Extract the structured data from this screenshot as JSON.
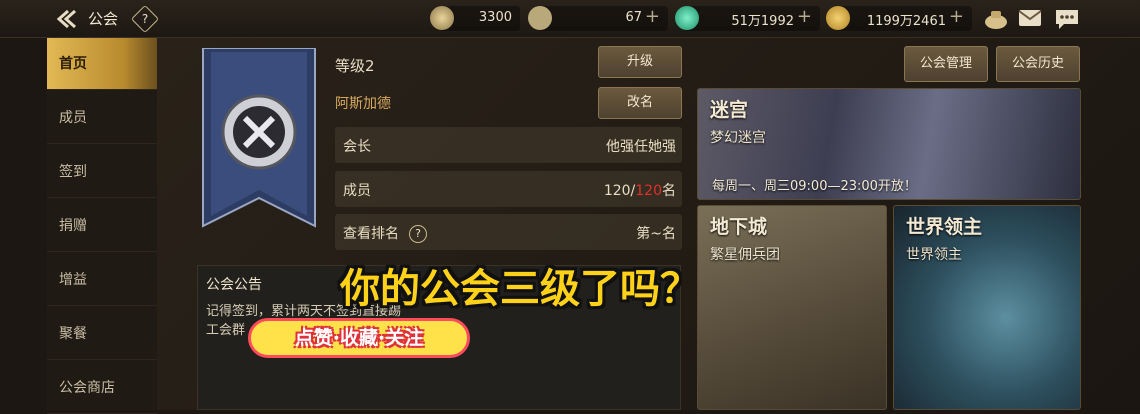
{
  "topbar": {
    "title": "公会",
    "help": "?",
    "resources": [
      {
        "icon": "gear-coin-icon",
        "value": "3300",
        "plus": ""
      },
      {
        "icon": "c-coin-icon",
        "value": "67",
        "plus": "+"
      },
      {
        "icon": "green-gem-icon",
        "value": "51万1992",
        "plus": "+"
      },
      {
        "icon": "gold-coin-icon",
        "value": "1199万2461",
        "plus": "+"
      }
    ]
  },
  "sidebar": {
    "items": [
      "首页",
      "成员",
      "签到",
      "捐赠",
      "增益",
      "聚餐",
      "公会商店"
    ],
    "active_index": 0
  },
  "guild": {
    "level": "等级2",
    "name": "阿斯加德",
    "upgrade_label": "升级",
    "rename_label": "改名",
    "manage_label": "公会管理",
    "history_label": "公会历史",
    "leader_key": "会长",
    "leader_value": "他强任她强",
    "members_key": "成员",
    "members_current": "120/",
    "members_max": "120",
    "members_unit": "名",
    "rank_key": "查看排名",
    "rank_help": "?",
    "rank_value": "第~名"
  },
  "notice": {
    "title": "公会公告",
    "body": "记得签到，累计两天不签到直接踢",
    "body2": "工会群"
  },
  "cards": {
    "maze": {
      "title": "迷宫",
      "subtitle": "梦幻迷宫",
      "schedule": "每周一、周三09:00—23:00开放！"
    },
    "dungeon": {
      "title": "地下城",
      "subtitle": "繁星佣兵团"
    },
    "boss": {
      "title": "世界领主",
      "subtitle": "世界领主"
    }
  },
  "overlay": {
    "caption": "你的公会三级了吗？",
    "sticker": "点赞·收藏·关注"
  },
  "colors": {
    "accent": "#e2b954",
    "member_max": "#e0302e",
    "caption": "#ffd21a"
  }
}
